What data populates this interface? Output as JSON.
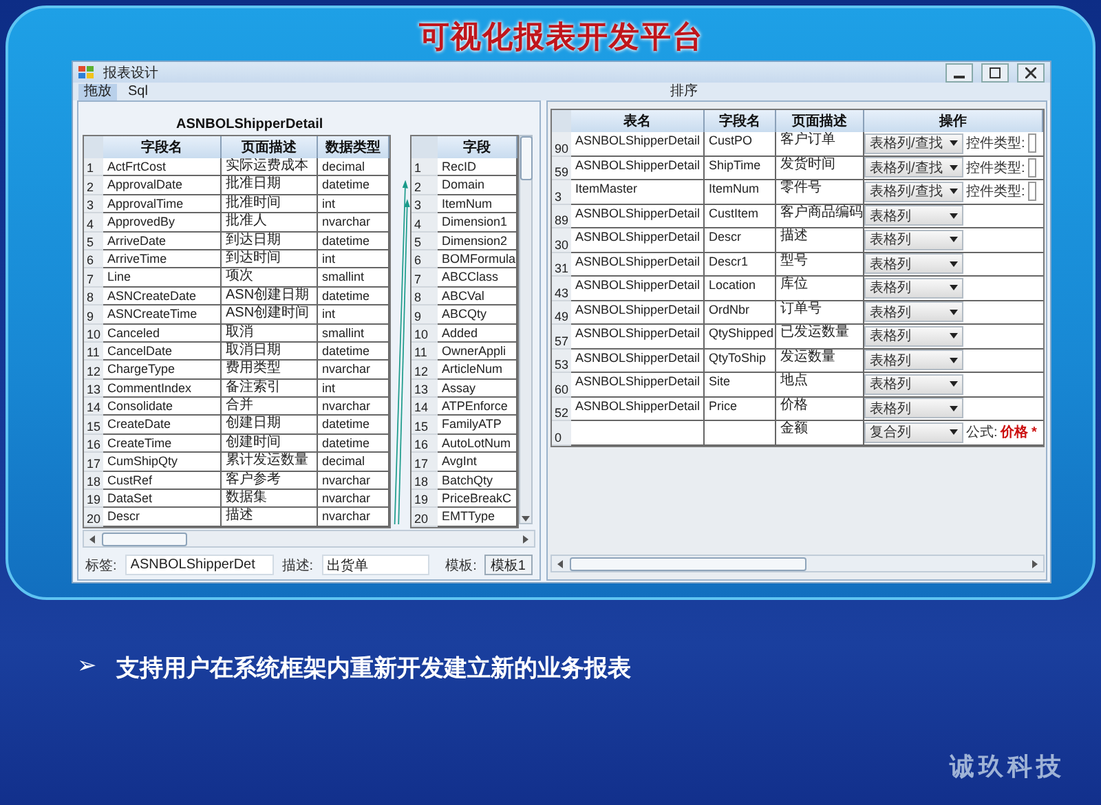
{
  "slide": {
    "title": "可视化报表开发平台",
    "bullet_marker": "➢",
    "bullet": "支持用户在系统框架内重新开发建立新的业务报表",
    "logo": "诚玖科技"
  },
  "window": {
    "title": "报表设计",
    "tabs": [
      {
        "label": "拖放",
        "selected": true
      },
      {
        "label": "Sql",
        "selected": false
      }
    ],
    "right_menu": [
      "排序"
    ]
  },
  "left_pane": {
    "table_title": "ASNBOLShipperDetail",
    "columns": [
      "字段名",
      "页面描述",
      "数据类型"
    ],
    "rows": [
      {
        "n": "1",
        "name": "ActFrtCost",
        "desc": "实际运费成本",
        "type": "decimal"
      },
      {
        "n": "2",
        "name": "ApprovalDate",
        "desc": "批准日期",
        "type": "datetime"
      },
      {
        "n": "3",
        "name": "ApprovalTime",
        "desc": "批准时间",
        "type": "int"
      },
      {
        "n": "4",
        "name": "ApprovedBy",
        "desc": "批准人",
        "type": "nvarchar"
      },
      {
        "n": "5",
        "name": "ArriveDate",
        "desc": "到达日期",
        "type": "datetime"
      },
      {
        "n": "6",
        "name": "ArriveTime",
        "desc": "到达时间",
        "type": "int"
      },
      {
        "n": "7",
        "name": "Line",
        "desc": "项次",
        "type": "smallint"
      },
      {
        "n": "8",
        "name": "ASNCreateDate",
        "desc": "ASN创建日期",
        "type": "datetime"
      },
      {
        "n": "9",
        "name": "ASNCreateTime",
        "desc": "ASN创建时间",
        "type": "int"
      },
      {
        "n": "10",
        "name": "Canceled",
        "desc": "取消",
        "type": "smallint"
      },
      {
        "n": "11",
        "name": "CancelDate",
        "desc": "取消日期",
        "type": "datetime"
      },
      {
        "n": "12",
        "name": "ChargeType",
        "desc": "费用类型",
        "type": "nvarchar"
      },
      {
        "n": "13",
        "name": "CommentIndex",
        "desc": "备注索引",
        "type": "int"
      },
      {
        "n": "14",
        "name": "Consolidate",
        "desc": "合并",
        "type": "nvarchar"
      },
      {
        "n": "15",
        "name": "CreateDate",
        "desc": "创建日期",
        "type": "datetime"
      },
      {
        "n": "16",
        "name": "CreateTime",
        "desc": "创建时间",
        "type": "datetime"
      },
      {
        "n": "17",
        "name": "CumShipQty",
        "desc": "累计发运数量",
        "type": "decimal"
      },
      {
        "n": "18",
        "name": "CustRef",
        "desc": "客户参考",
        "type": "nvarchar"
      },
      {
        "n": "19",
        "name": "DataSet",
        "desc": "数据集",
        "type": "nvarchar"
      },
      {
        "n": "20",
        "name": "Descr",
        "desc": "描述",
        "type": "nvarchar"
      }
    ],
    "table2": {
      "column": "字段",
      "rows": [
        {
          "n": "1",
          "name": "RecID"
        },
        {
          "n": "2",
          "name": "Domain"
        },
        {
          "n": "3",
          "name": "ItemNum"
        },
        {
          "n": "4",
          "name": "Dimension1"
        },
        {
          "n": "5",
          "name": "Dimension2"
        },
        {
          "n": "6",
          "name": "BOMFormula"
        },
        {
          "n": "7",
          "name": "ABCClass"
        },
        {
          "n": "8",
          "name": "ABCVal"
        },
        {
          "n": "9",
          "name": "ABCQty"
        },
        {
          "n": "10",
          "name": "Added"
        },
        {
          "n": "11",
          "name": "OwnerAppli"
        },
        {
          "n": "12",
          "name": "ArticleNum"
        },
        {
          "n": "13",
          "name": "Assay"
        },
        {
          "n": "14",
          "name": "ATPEnforce"
        },
        {
          "n": "15",
          "name": "FamilyATP"
        },
        {
          "n": "16",
          "name": "AutoLotNum"
        },
        {
          "n": "17",
          "name": "AvgInt"
        },
        {
          "n": "18",
          "name": "BatchQty"
        },
        {
          "n": "19",
          "name": "PriceBreakC"
        },
        {
          "n": "20",
          "name": "EMTType"
        }
      ]
    },
    "footer": {
      "label_caption": "标签:",
      "label_value": "ASNBOLShipperDet",
      "desc_caption": "描述:",
      "desc_value": "出货单",
      "template_caption": "模板:",
      "template_value": "模板1"
    }
  },
  "right_pane": {
    "columns": [
      "表名",
      "字段名",
      "页面描述",
      "操作"
    ],
    "rows": [
      {
        "n": "90",
        "table": "ASNBOLShipperDetail",
        "field": "CustPO",
        "desc": "客户订单",
        "mode": "表格列/查找",
        "extra": {
          "kind": "control",
          "label": "控件类型:"
        }
      },
      {
        "n": "59",
        "table": "ASNBOLShipperDetail",
        "field": "ShipTime",
        "desc": "发货时间",
        "mode": "表格列/查找",
        "extra": {
          "kind": "control",
          "label": "控件类型:"
        }
      },
      {
        "n": "3",
        "table": "ItemMaster",
        "field": "ItemNum",
        "desc": "零件号",
        "mode": "表格列/查找",
        "extra": {
          "kind": "control",
          "label": "控件类型:"
        }
      },
      {
        "n": "89",
        "table": "ASNBOLShipperDetail",
        "field": "CustItem",
        "desc": "客户商品编码",
        "mode": "表格列"
      },
      {
        "n": "30",
        "table": "ASNBOLShipperDetail",
        "field": "Descr",
        "desc": "描述",
        "mode": "表格列"
      },
      {
        "n": "31",
        "table": "ASNBOLShipperDetail",
        "field": "Descr1",
        "desc": "型号",
        "mode": "表格列"
      },
      {
        "n": "43",
        "table": "ASNBOLShipperDetail",
        "field": "Location",
        "desc": "库位",
        "mode": "表格列"
      },
      {
        "n": "49",
        "table": "ASNBOLShipperDetail",
        "field": "OrdNbr",
        "desc": "订单号",
        "mode": "表格列"
      },
      {
        "n": "57",
        "table": "ASNBOLShipperDetail",
        "field": "QtyShipped",
        "desc": "已发运数量",
        "mode": "表格列"
      },
      {
        "n": "53",
        "table": "ASNBOLShipperDetail",
        "field": "QtyToShip",
        "desc": "发运数量",
        "mode": "表格列"
      },
      {
        "n": "60",
        "table": "ASNBOLShipperDetail",
        "field": "Site",
        "desc": "地点",
        "mode": "表格列"
      },
      {
        "n": "52",
        "table": "ASNBOLShipperDetail",
        "field": "Price",
        "desc": "价格",
        "mode": "表格列"
      },
      {
        "n": "0",
        "desc": "金额",
        "mode": "复合列",
        "extra": {
          "kind": "formula",
          "label": "公式:",
          "value": "价格 *"
        }
      }
    ]
  }
}
